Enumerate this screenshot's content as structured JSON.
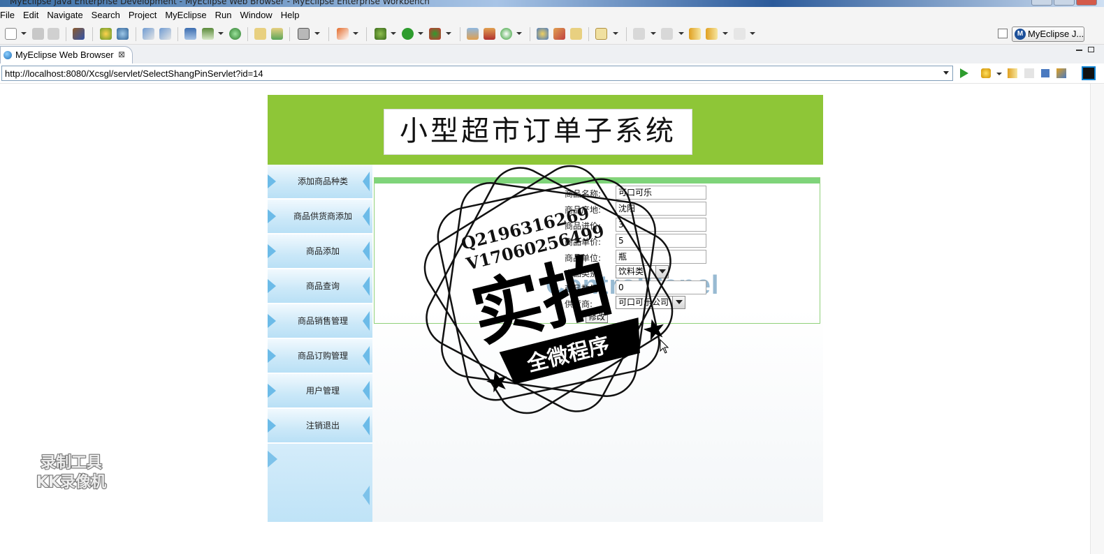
{
  "window": {
    "title": "MyEclipse Java Enterprise Development - MyEclipse Web Browser - MyEclipse Enterprise Workbench"
  },
  "menu": [
    "File",
    "Edit",
    "Navigate",
    "Search",
    "Project",
    "MyEclipse",
    "Run",
    "Window",
    "Help"
  ],
  "perspective": {
    "label": "MyEclipse J..."
  },
  "editor_tab": {
    "label": "MyEclipse Web Browser",
    "close": "⊠"
  },
  "browser": {
    "url": "http://localhost:8080/Xcsgl/servlet/SelectShangPinServlet?id=14"
  },
  "site": {
    "title": "小型超市订单子系统",
    "sidebar": [
      "添加商品种类",
      "商品供货商添加",
      "商品添加",
      "商品查询",
      "商品销售管理",
      "商品订购管理",
      "用户管理",
      "注销退出"
    ],
    "watermark": "ControlPanel"
  },
  "form": {
    "fields": [
      {
        "label": "商品名称:",
        "value": "可口可乐"
      },
      {
        "label": "商品产地:",
        "value": "沈阳"
      },
      {
        "label": "商品进价:",
        "value": "3"
      },
      {
        "label": "商品单价:",
        "value": "5"
      },
      {
        "label": "商品单位:",
        "value": "瓶"
      },
      {
        "label": "商品类别:",
        "value": "饮料类",
        "type": "select"
      },
      {
        "label": "商品数量:",
        "value": "0"
      },
      {
        "label": "供货商:",
        "value": "可口可乐公司",
        "type": "select"
      }
    ],
    "submit": "修改"
  },
  "overlay": {
    "qq": "Q2196316269",
    "wechat": "V17060256499",
    "stamp_main": "实拍",
    "stamp_ribbon": "全微程序",
    "recorder_line1": "录制工具",
    "recorder_line2": "KK录像机"
  }
}
